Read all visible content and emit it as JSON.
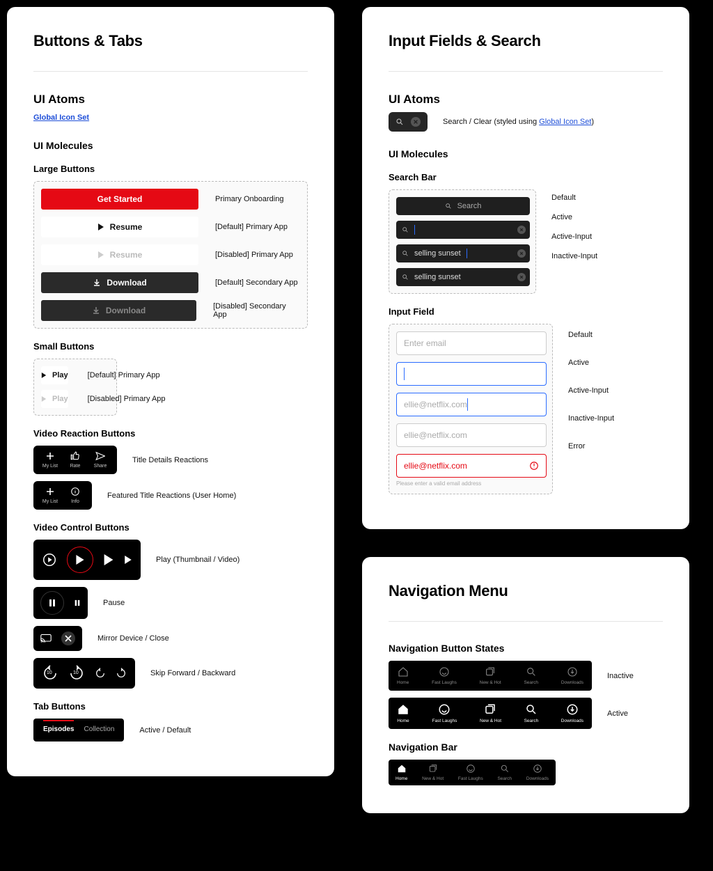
{
  "buttons": {
    "title": "Buttons & Tabs",
    "atoms_heading": "UI Atoms",
    "global_icon_link": "Global Icon Set",
    "molecules_heading": "UI Molecules",
    "large_heading": "Large Buttons",
    "large": [
      {
        "label": "Get Started",
        "desc": "Primary Onboarding"
      },
      {
        "label": "Resume",
        "desc": "[Default] Primary App"
      },
      {
        "label": "Resume",
        "desc": "[Disabled] Primary App"
      },
      {
        "label": "Download",
        "desc": "[Default] Secondary App"
      },
      {
        "label": "Download",
        "desc": "[Disabled] Secondary App"
      }
    ],
    "small_heading": "Small Buttons",
    "small": [
      {
        "label": "Play",
        "desc": "[Default] Primary App"
      },
      {
        "label": "Play",
        "desc": "[Disabled] Primary App"
      }
    ],
    "reaction_heading": "Video Reaction Buttons",
    "reactions_title_desc": "Title Details Reactions",
    "reactions_featured_desc": "Featured Title Reactions (User Home)",
    "reaction_items": [
      {
        "label": "My List"
      },
      {
        "label": "Rate"
      },
      {
        "label": "Share"
      }
    ],
    "reaction_featured": [
      {
        "label": "My List"
      },
      {
        "label": "Info"
      }
    ],
    "vc_heading": "Video Control Buttons",
    "vc": {
      "play": "Play (Thumbnail / Video)",
      "pause": "Pause",
      "mirror": "Mirror Device / Close",
      "skip": "Skip Forward / Backward",
      "skip_value": "10"
    },
    "tab_heading": "Tab Buttons",
    "tabs": {
      "episodes": "Episodes",
      "collection": "Collection",
      "desc": "Active / Default"
    }
  },
  "inputs": {
    "title": "Input Fields & Search",
    "atoms_heading": "UI Atoms",
    "atoms_desc_prefix": "Search / Clear (styled using ",
    "atoms_desc_link": "Global Icon Set",
    "atoms_desc_suffix": ")",
    "molecules_heading": "UI Molecules",
    "search_heading": "Search Bar",
    "search": {
      "placeholder": "Search",
      "value": "selling sunset",
      "states": {
        "default": "Default",
        "active": "Active",
        "active_input": "Active-Input",
        "inactive_input": "Inactive-Input"
      }
    },
    "input_heading": "Input Field",
    "field": {
      "placeholder": "Enter email",
      "value": "ellie@netflix.com",
      "error_msg": "Please enter a valid email address",
      "states": {
        "default": "Default",
        "active": "Active",
        "active_input": "Active-Input",
        "inactive_input": "Inactive-Input",
        "error": "Error"
      }
    }
  },
  "nav": {
    "title": "Navigation Menu",
    "states_heading": "Navigation Button States",
    "states": {
      "inactive": "Inactive",
      "active": "Active"
    },
    "bar_heading": "Navigation Bar",
    "items": [
      {
        "label": "Home"
      },
      {
        "label": "Fast Laughs"
      },
      {
        "label": "New & Hot"
      },
      {
        "label": "Search"
      },
      {
        "label": "Downloads"
      }
    ],
    "bar_items": [
      {
        "label": "Home"
      },
      {
        "label": "New & Hot"
      },
      {
        "label": "Fast Laughs"
      },
      {
        "label": "Search"
      },
      {
        "label": "Downloads"
      }
    ]
  }
}
